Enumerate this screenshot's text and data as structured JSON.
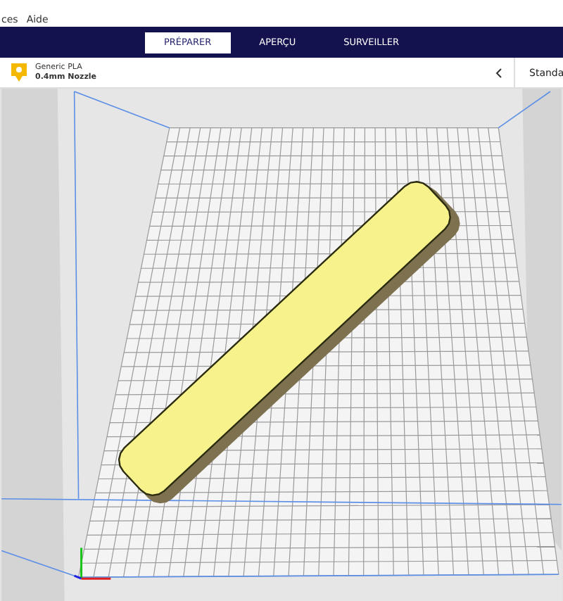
{
  "menu_bar": {
    "items": [
      "ces",
      "Aide"
    ]
  },
  "tabs": [
    {
      "label": "PRÉPARER",
      "selected": true
    },
    {
      "label": "APERÇU",
      "selected": false
    },
    {
      "label": "SURVEILLER",
      "selected": false
    }
  ],
  "printer_bar": {
    "material": "Generic PLA",
    "nozzle": "0.4mm Nozzle",
    "profile": "Standa"
  }
}
